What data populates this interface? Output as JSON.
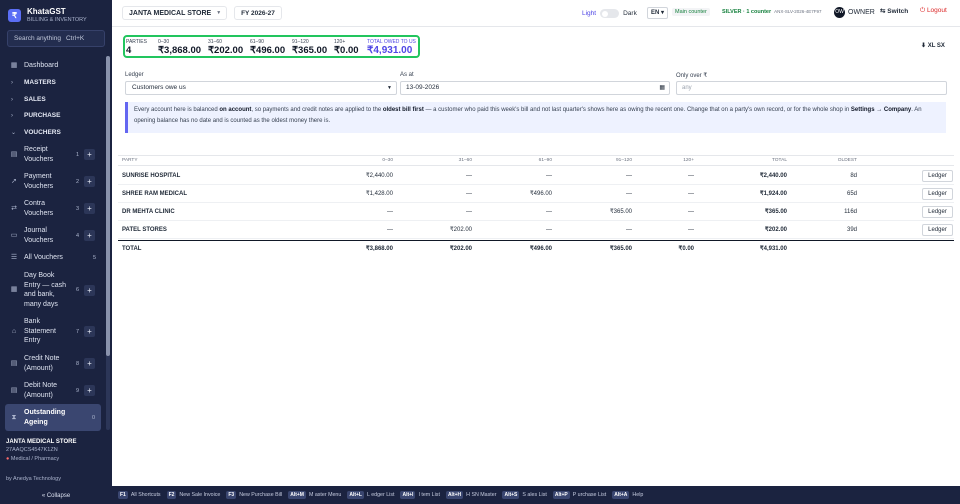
{
  "brand": {
    "name": "KhataGST",
    "subtitle": "BILLING & INVENTORY",
    "logo": "₹"
  },
  "search": {
    "placeholder": "Search anything",
    "shortcut": "Ctrl+K"
  },
  "sidebar": {
    "dashboard": "Dashboard",
    "sections": [
      "MASTERS",
      "SALES",
      "PURCHASE",
      "VOUCHERS"
    ],
    "vouchers": [
      {
        "label": "Receipt Vouchers",
        "num": "1"
      },
      {
        "label": "Payment Vouchers",
        "num": "2"
      },
      {
        "label": "Contra Vouchers",
        "num": "3"
      },
      {
        "label": "Journal Vouchers",
        "num": "4"
      },
      {
        "label": "All Vouchers",
        "num": "5"
      },
      {
        "label": "Day Book Entry — cash and bank, many days",
        "num": "6"
      },
      {
        "label": "Bank Statement Entry",
        "num": "7"
      },
      {
        "label": "Credit Note (Amount)",
        "num": "8"
      },
      {
        "label": "Debit Note (Amount)",
        "num": "9"
      },
      {
        "label": "Outstanding Ageing",
        "num": "0"
      }
    ],
    "shop_name": "JANTA MEDICAL STORE",
    "gstin": "27AAQCS4547K1ZN",
    "category": "Medical / Pharmacy",
    "by": "by Anedya Technology",
    "collapse": "« Collapse"
  },
  "topbar": {
    "shop": "JANTA MEDICAL STORE",
    "fy": "FY 2026-27",
    "light": "Light",
    "dark": "Dark",
    "lang": "EN",
    "counter": "Main counter",
    "plan": "SILVER · 1 counter",
    "plan_key": "ANX-SLV-2026-4E7F97",
    "avatar": "OW",
    "role": "OWNER",
    "switch": "⇆ Switch",
    "logout": "⏻ Logout"
  },
  "summary": {
    "cols": [
      {
        "label": "PARTIES",
        "value": "4"
      },
      {
        "label": "0–30",
        "value": "₹3,868.00"
      },
      {
        "label": "31–60",
        "value": "₹202.00"
      },
      {
        "label": "61–90",
        "value": "₹496.00"
      },
      {
        "label": "91–120",
        "value": "₹365.00"
      },
      {
        "label": "120+",
        "value": "₹0.00"
      },
      {
        "label": "TOTAL OWED TO US",
        "value": "₹4,931.00"
      }
    ],
    "export": "⬇ XL SX"
  },
  "filters": {
    "ledger_label": "Ledger",
    "ledger_value": "Customers owe us",
    "asat_label": "As at",
    "asat_value": "13-09-2026",
    "only_label": "Only over ₹",
    "only_placeholder": "any"
  },
  "info": {
    "p1": "Every account here is balanced ",
    "b1": "on account",
    "p2": ", so payments and credit notes are applied to the ",
    "b2": "oldest bill first",
    "p3": " — a customer who paid this week's bill and not last quarter's shows here as owing the recent one. Change that on a party's own record, or for the whole shop in ",
    "b3": "Settings → Company",
    "p4": ". An opening balance has no date and is counted as the oldest money there is."
  },
  "table": {
    "headers": [
      "PARTY",
      "0–30",
      "31–60",
      "61–90",
      "91–120",
      "120+",
      "TOTAL",
      "OLDEST"
    ],
    "rows": [
      {
        "party": "SUNRISE HOSPITAL",
        "b0": "₹2,440.00",
        "b1": "—",
        "b2": "—",
        "b3": "—",
        "b4": "—",
        "total": "₹2,440.00",
        "oldest": "8d",
        "action": "Ledger"
      },
      {
        "party": "SHREE RAM MEDICAL",
        "b0": "₹1,428.00",
        "b1": "—",
        "b2": "₹496.00",
        "b3": "—",
        "b4": "—",
        "total": "₹1,924.00",
        "oldest": "65d",
        "action": "Ledger"
      },
      {
        "party": "DR MEHTA CLINIC",
        "b0": "—",
        "b1": "—",
        "b2": "—",
        "b3": "₹365.00",
        "b4": "—",
        "total": "₹365.00",
        "oldest": "116d",
        "action": "Ledger"
      },
      {
        "party": "PATEL STORES",
        "b0": "—",
        "b1": "₹202.00",
        "b2": "—",
        "b3": "—",
        "b4": "—",
        "total": "₹202.00",
        "oldest": "39d",
        "action": "Ledger"
      }
    ],
    "footer": {
      "label": "TOTAL",
      "b0": "₹3,868.00",
      "b1": "₹202.00",
      "b2": "₹496.00",
      "b3": "₹365.00",
      "b4": "₹0.00",
      "total": "₹4,931.00"
    }
  },
  "shortcuts": [
    {
      "key": "F1",
      "label": "All Shortcuts"
    },
    {
      "key": "F2",
      "label": "New Sale Invoice"
    },
    {
      "key": "F3",
      "label": "New Purchase Bill"
    },
    {
      "key": "Alt+M",
      "label": "M aster Menu"
    },
    {
      "key": "Alt+L",
      "label": "L edger List"
    },
    {
      "key": "Alt+I",
      "label": "I tem List"
    },
    {
      "key": "Alt+H",
      "label": "H SN Master"
    },
    {
      "key": "Alt+S",
      "label": "S ales List"
    },
    {
      "key": "Alt+P",
      "label": "P urchase List"
    },
    {
      "key": "Alt+A",
      "label": "Help"
    }
  ]
}
